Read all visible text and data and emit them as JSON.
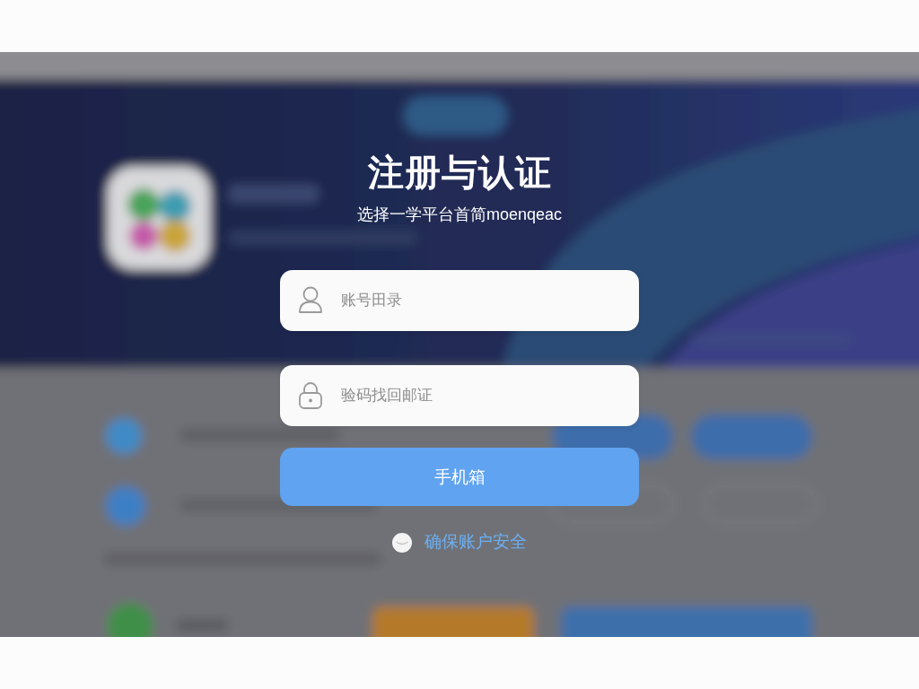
{
  "dialog": {
    "title": "注册与认证",
    "subtitle": "选择一学平台首简moenqeac",
    "fields": [
      {
        "kind": "account",
        "placeholder": "账号田录"
      },
      {
        "kind": "password",
        "placeholder": "验码找回邮证"
      }
    ],
    "submit_button": "手机箱",
    "security_link": "确保账户安全"
  }
}
